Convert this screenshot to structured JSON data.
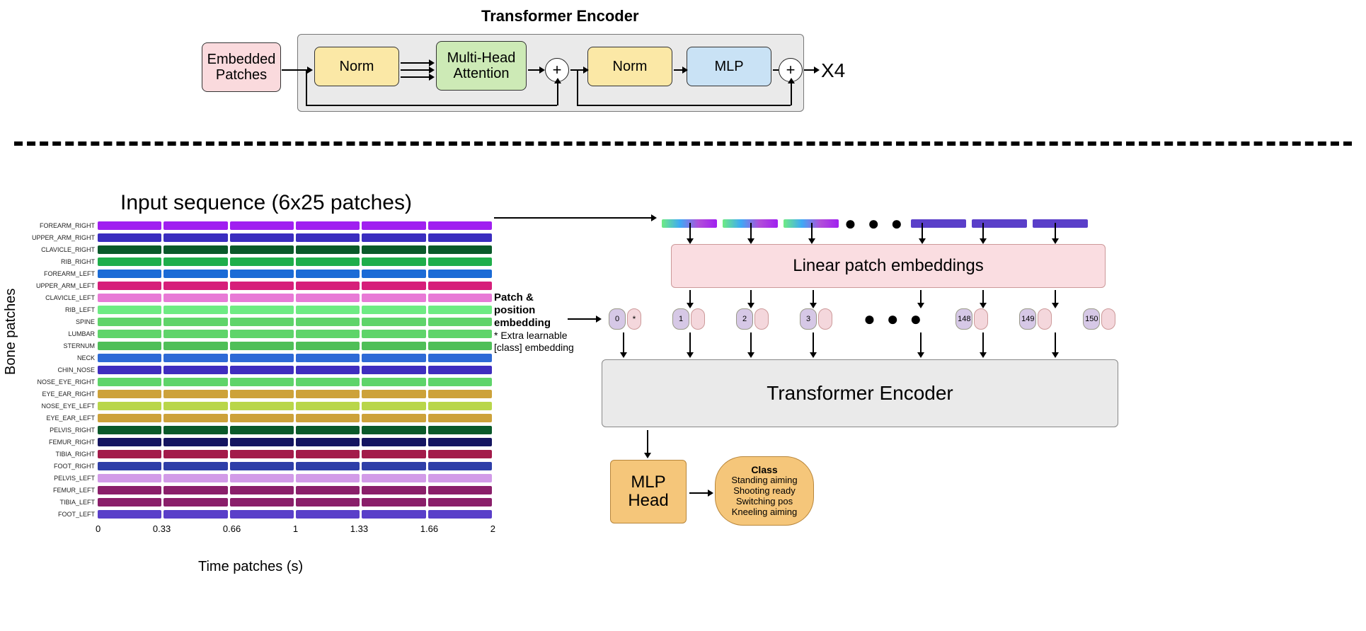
{
  "top": {
    "title": "Transformer Encoder",
    "embedded_patches": "Embedded\nPatches",
    "norm1": "Norm",
    "mha": "Multi-Head\nAttention",
    "plus": "+",
    "norm2": "Norm",
    "mlp": "MLP",
    "repeat": "X4"
  },
  "bottom": {
    "input_title": "Input sequence (6x25 patches)",
    "bone_axis": "Bone patches",
    "time_axis": "Time patches (s)",
    "time_ticks": [
      "0",
      "0.33",
      "0.66",
      "1",
      "1.33",
      "1.66",
      "2"
    ],
    "bones": [
      "FOREARM_RIGHT",
      "UPPER_ARM_RIGHT",
      "CLAVICLE_RIGHT",
      "RIB_RIGHT",
      "FOREARM_LEFT",
      "UPPER_ARM_LEFT",
      "CLAVICLE_LEFT",
      "RIB_LEFT",
      "SPINE",
      "LUMBAR",
      "STERNUM",
      "NECK",
      "CHIN_NOSE",
      "NOSE_EYE_RIGHT",
      "EYE_EAR_RIGHT",
      "NOSE_EYE_LEFT",
      "EYE_EAR_LEFT",
      "PELVIS_RIGHT",
      "FEMUR_RIGHT",
      "TIBIA_RIGHT",
      "FOOT_RIGHT",
      "PELVIS_LEFT",
      "FEMUR_LEFT",
      "TIBIA_LEFT",
      "FOOT_LEFT"
    ],
    "bone_colors": [
      "#a020f0",
      "#3b2dbf",
      "#0a5a2a",
      "#1fae4a",
      "#1b6bd6",
      "#d61f7a",
      "#e87ad6",
      "#6eeb83",
      "#5fd46a",
      "#5fd46a",
      "#4fbf58",
      "#2e6ad6",
      "#3f2dbf",
      "#5fd46a",
      "#cda23a",
      "#b9d64a",
      "#cda23a",
      "#0a5a2a",
      "#151560",
      "#a31b4a",
      "#2e3ea8",
      "#d29be8",
      "#8a1f6a",
      "#8a1f6a",
      "#5a3fc9"
    ],
    "patch_pos": "Patch & position embedding",
    "extra_learn": "* Extra learnable [class] embedding",
    "linear_emb": "Linear patch embeddings",
    "tf_encoder": "Transformer Encoder",
    "mlp_head": "MLP Head",
    "class_hdr": "Class",
    "classes": [
      "Standing aiming",
      "Shooting ready",
      "Switching pos",
      "Kneeling aiming"
    ],
    "tokens": [
      "0",
      "1",
      "2",
      "3",
      "148",
      "149",
      "150"
    ],
    "star": "*",
    "ellipsis": "● ● ●"
  }
}
